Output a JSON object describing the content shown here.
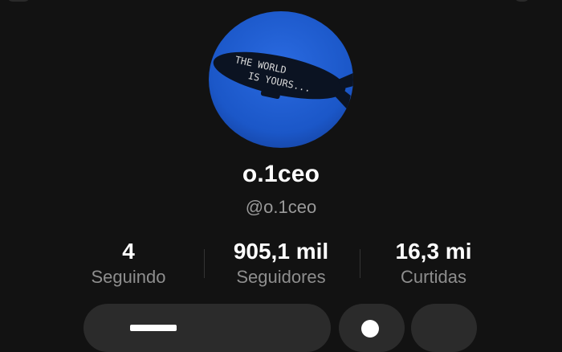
{
  "profile": {
    "avatar_text_line1": "THE WORLD",
    "avatar_text_line2": "IS YOURS...",
    "display_name": "o.1ceo",
    "handle": "@o.1ceo"
  },
  "stats": {
    "following": {
      "value": "4",
      "label": "Seguindo"
    },
    "followers": {
      "value": "905,1 mil",
      "label": "Seguidores"
    },
    "likes": {
      "value": "16,3 mi",
      "label": "Curtidas"
    }
  },
  "colors": {
    "background": "#121212",
    "avatar_sky": "#1b57c8",
    "muted_text": "#8e8e8e",
    "button_bg": "#2b2b2b"
  }
}
